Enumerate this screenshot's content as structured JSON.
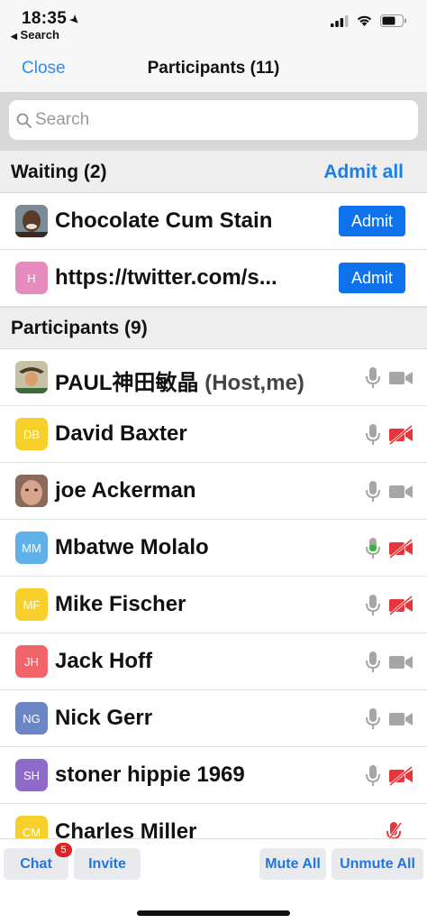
{
  "status_bar": {
    "time": "18:35",
    "back_label": "Search"
  },
  "nav": {
    "close_label": "Close",
    "title": "Participants (11)"
  },
  "search": {
    "placeholder": "Search"
  },
  "waiting": {
    "title": "Waiting (2)",
    "admit_all_label": "Admit all",
    "items": [
      {
        "name": "Chocolate Cum Stain",
        "initials": "",
        "avatar_color": "#6b4a3a",
        "button": "Admit"
      },
      {
        "name": "https://twitter.com/s...",
        "initials": "H",
        "avatar_color": "#e58cbd",
        "button": "Admit"
      }
    ]
  },
  "participants": {
    "title": "Participants (9)",
    "items": [
      {
        "name": "PAUL神田敏晶",
        "role": " (Host,me)",
        "initials": "",
        "avatar_color": "#a99a7a",
        "mic": "on",
        "video": "on"
      },
      {
        "name": "David Baxter",
        "initials": "DB",
        "avatar_color": "#f7d02b",
        "mic": "on",
        "video": "off"
      },
      {
        "name": "joe Ackerman",
        "initials": "",
        "avatar_color": "#b98a73",
        "mic": "on",
        "video": "on"
      },
      {
        "name": "Mbatwe Molalo",
        "initials": "MM",
        "avatar_color": "#5fb1ea",
        "mic": "active",
        "video": "off"
      },
      {
        "name": "Mike Fischer",
        "initials": "MF",
        "avatar_color": "#f7d02b",
        "mic": "on",
        "video": "off"
      },
      {
        "name": "Jack Hoff",
        "initials": "JH",
        "avatar_color": "#f0646a",
        "mic": "on",
        "video": "on"
      },
      {
        "name": "Nick Gerr",
        "initials": "NG",
        "avatar_color": "#6a86c7",
        "mic": "on",
        "video": "on"
      },
      {
        "name": "stoner hippie 1969",
        "initials": "SH",
        "avatar_color": "#8e6bc9",
        "mic": "on",
        "video": "off"
      },
      {
        "name": "Charles Miller",
        "initials": "CM",
        "avatar_color": "#f7d02b",
        "mic": "muted",
        "video": "none"
      }
    ]
  },
  "bottom_bar": {
    "chat_label": "Chat",
    "chat_badge": "5",
    "invite_label": "Invite",
    "mute_all_label": "Mute All",
    "unmute_all_label": "Unmute All"
  },
  "colors": {
    "accent": "#1a7fe6",
    "admit_button": "#0e72ed",
    "video_off": "#e8343b",
    "mic_active": "#3bb23b"
  }
}
